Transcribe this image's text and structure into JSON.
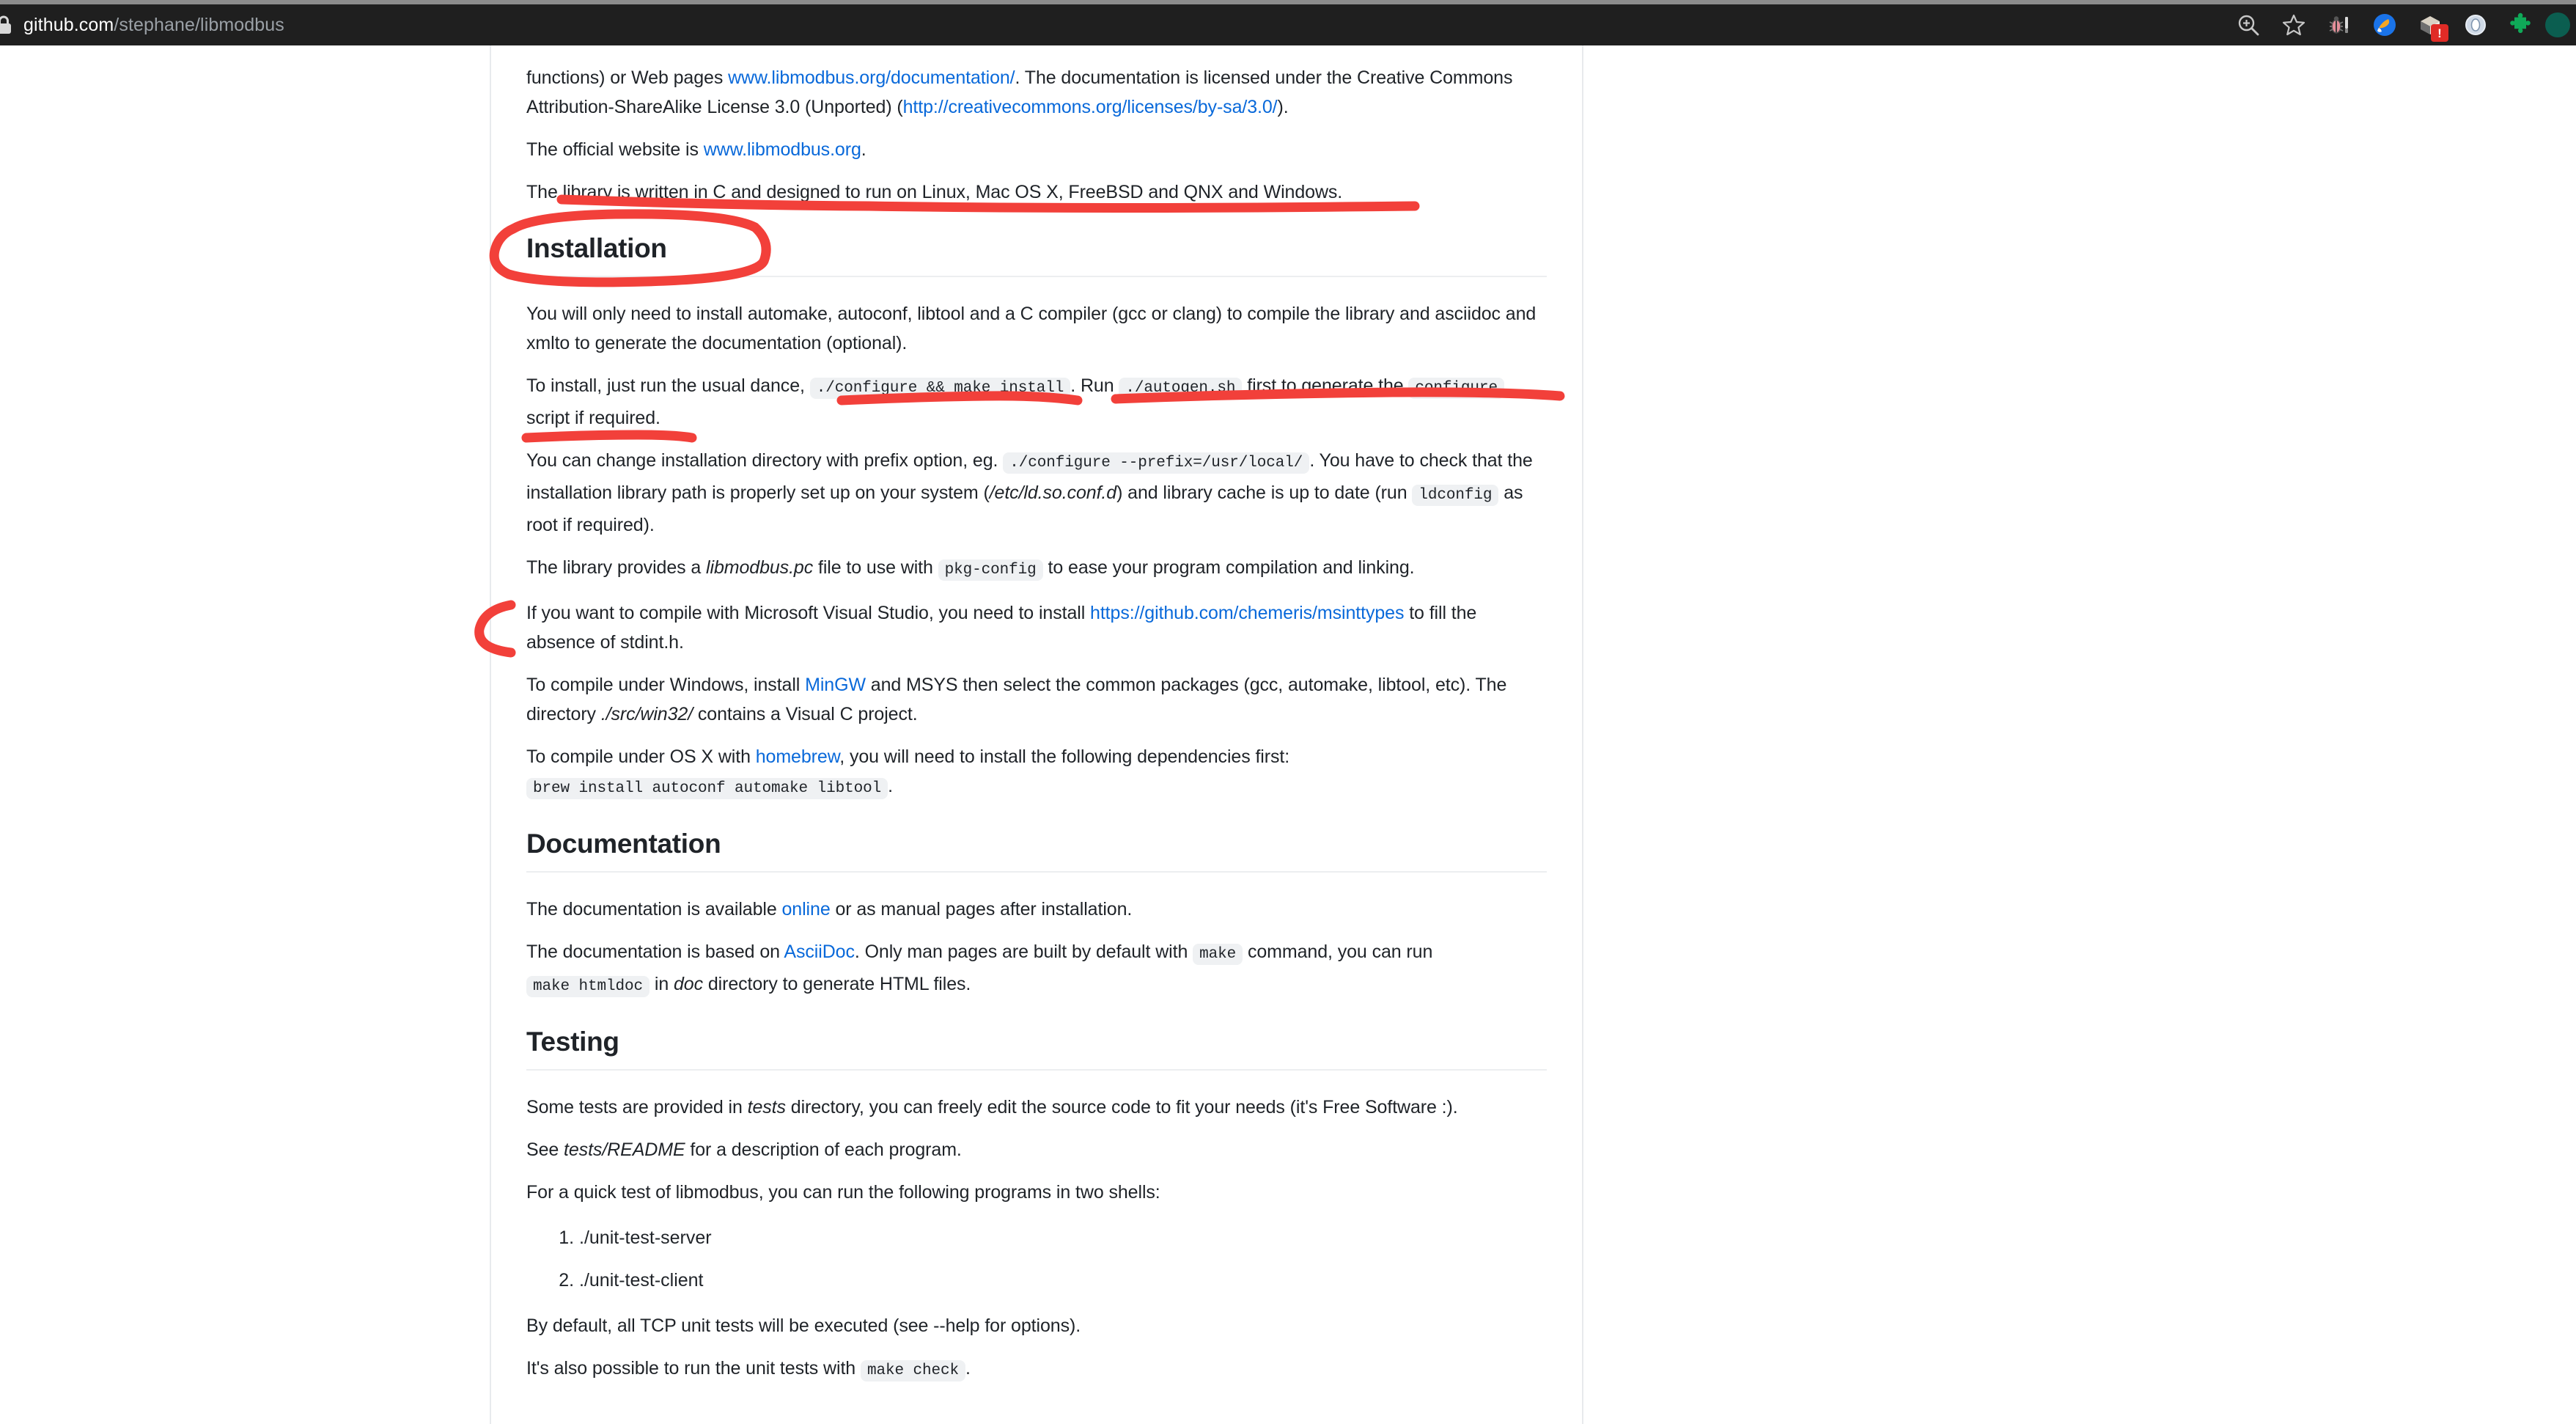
{
  "browser": {
    "address_bar": {
      "host": "github.com",
      "path": "/stephane/libmodbus",
      "lock_icon": "lock-icon"
    },
    "toolbar_icons": [
      {
        "name": "zoom-in-icon",
        "label": "Zoom"
      },
      {
        "name": "bookmark-star-icon",
        "label": "Bookmark this tab"
      },
      {
        "name": "bug-extension-icon",
        "label": "Debug extension"
      },
      {
        "name": "brush-extension-icon",
        "label": "Styling extension"
      },
      {
        "name": "package-extension-icon",
        "label": "Package extension",
        "badge": "!"
      },
      {
        "name": "ring-extension-icon",
        "label": "Ring extension"
      },
      {
        "name": "puzzle-extensions-icon",
        "label": "Extensions"
      },
      {
        "name": "profile-avatar-icon",
        "label": "Profile"
      }
    ],
    "badge_color": "#e02b26"
  },
  "document": {
    "intro": {
      "p1_a": "functions) or Web pages ",
      "p1_link1": "www.libmodbus.org/documentation/",
      "p1_b": ". The documentation is licensed under the Creative Commons Attribution-ShareAlike License 3.0 (Unported) (",
      "p1_link2": "http://creativecommons.org/licenses/by-sa/3.0/",
      "p1_c": ").",
      "p2_a": "The official website is ",
      "p2_link": "www.libmodbus.org",
      "p2_b": ".",
      "p3": "The library is written in C and designed to run on Linux, Mac OS X, FreeBSD and QNX and Windows."
    },
    "installation": {
      "heading": "Installation",
      "p1": "You will only need to install automake, autoconf, libtool and a C compiler (gcc or clang) to compile the library and asciidoc and xmlto to generate the documentation (optional).",
      "p2_a": "To install, just run the usual dance, ",
      "p2_code1": "./configure && make install",
      "p2_b": ". Run ",
      "p2_code2": "./autogen.sh",
      "p2_c": " first to generate the ",
      "p2_code3": "configure",
      "p2_d": " script if required.",
      "p3_a": "You can change installation directory with prefix option, eg. ",
      "p3_code1": "./configure --prefix=/usr/local/",
      "p3_b": ". You have to check that the installation library path is properly set up on your system (",
      "p3_ital": "/etc/ld.so.conf.d",
      "p3_c": ") and library cache is up to date (run ",
      "p3_code2": "ldconfig",
      "p3_d": " as root if required).",
      "p4_a": "The library provides a ",
      "p4_ital": "libmodbus.pc",
      "p4_b": " file to use with ",
      "p4_code": "pkg-config",
      "p4_c": " to ease your program compilation and linking.",
      "p5_a": "If you want to compile with Microsoft Visual Studio, you need to install ",
      "p5_link": "https://github.com/chemeris/msinttypes",
      "p5_b": " to fill the absence of stdint.h.",
      "p6_a": "To compile under Windows, install ",
      "p6_link": "MinGW",
      "p6_b": " and MSYS then select the common packages (gcc, automake, libtool, etc). The directory ",
      "p6_ital": "./src/win32/",
      "p6_c": " contains a Visual C project.",
      "p7_a": "To compile under OS X with ",
      "p7_link": "homebrew",
      "p7_b": ", you will need to install the following dependencies first: ",
      "p7_code": "brew install autoconf automake libtool",
      "p7_c": "."
    },
    "documentation": {
      "heading": "Documentation",
      "p1_a": "The documentation is available ",
      "p1_link": "online",
      "p1_b": " or as manual pages after installation.",
      "p2_a": "The documentation is based on ",
      "p2_link": "AsciiDoc",
      "p2_b": ". Only man pages are built by default with ",
      "p2_code1": "make",
      "p2_c": " command, you can run ",
      "p2_code2": "make htmldoc",
      "p2_d": " in ",
      "p2_ital": "doc",
      "p2_e": " directory to generate HTML files."
    },
    "testing": {
      "heading": "Testing",
      "p1_a": "Some tests are provided in ",
      "p1_ital": "tests",
      "p1_b": " directory, you can freely edit the source code to fit your needs (it's Free Software :).",
      "p2_a": "See ",
      "p2_ital": "tests/README",
      "p2_b": " for a description of each program.",
      "p3": "For a quick test of libmodbus, you can run the following programs in two shells:",
      "shell_items": [
        "./unit-test-server",
        "./unit-test-client"
      ],
      "p4": "By default, all TCP unit tests will be executed (see --help for options).",
      "p5_a": "It's also possible to run the unit tests with ",
      "p5_code": "make check",
      "p5_b": "."
    }
  },
  "annotations": {
    "color": "#f2403a",
    "marks": [
      {
        "name": "underline-library-written-in-c",
        "type": "underline"
      },
      {
        "name": "ellipse-installation-heading",
        "type": "ellipse"
      },
      {
        "name": "underline-configure-make-install",
        "type": "underline"
      },
      {
        "name": "underline-script-if-required",
        "type": "underline"
      },
      {
        "name": "underline-autogen-configure",
        "type": "underline"
      },
      {
        "name": "bracket-msvc-paragraph",
        "type": "bracket"
      }
    ]
  }
}
